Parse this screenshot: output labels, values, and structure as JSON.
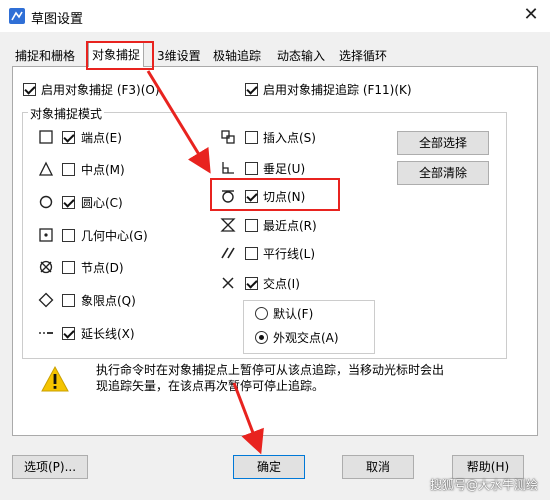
{
  "window": {
    "title": "草图设置",
    "close_glyph": "✕"
  },
  "tabs": [
    {
      "label": "捕捉和栅格",
      "active": false
    },
    {
      "label": "对象捕捉",
      "active": true
    },
    {
      "label": "3维设置",
      "active": false
    },
    {
      "label": "极轴追踪",
      "active": false
    },
    {
      "label": "动态输入",
      "active": false
    },
    {
      "label": "选择循环",
      "active": false
    }
  ],
  "snap_options": {
    "enable_osnap": {
      "label": "启用对象捕捉 (F3)(O)",
      "checked": true
    },
    "enable_tracking": {
      "label": "启用对象捕捉追踪 (F11)(K)",
      "checked": true
    }
  },
  "modes_group_title": "对象捕捉模式",
  "modes_left": [
    {
      "label": "端点(E)",
      "checked": true,
      "icon": "endpoint-square-icon"
    },
    {
      "label": "中点(M)",
      "checked": false,
      "icon": "midpoint-triangle-icon"
    },
    {
      "label": "圆心(C)",
      "checked": true,
      "icon": "center-circle-icon"
    },
    {
      "label": "几何中心(G)",
      "checked": false,
      "icon": "geometric-center-icon"
    },
    {
      "label": "节点(D)",
      "checked": false,
      "icon": "node-icon"
    },
    {
      "label": "象限点(Q)",
      "checked": false,
      "icon": "quadrant-diamond-icon"
    },
    {
      "label": "延长线(X)",
      "checked": true,
      "icon": "extension-icon"
    }
  ],
  "modes_right": [
    {
      "label": "插入点(S)",
      "checked": false,
      "icon": "insertion-icon"
    },
    {
      "label": "垂足(U)",
      "checked": false,
      "icon": "perpendicular-icon"
    },
    {
      "label": "切点(N)",
      "checked": true,
      "icon": "tangent-icon"
    },
    {
      "label": "最近点(R)",
      "checked": false,
      "icon": "nearest-icon"
    },
    {
      "label": "平行线(L)",
      "checked": false,
      "icon": "parallel-icon"
    },
    {
      "label": "交点(I)",
      "checked": true,
      "icon": "intersection-icon"
    }
  ],
  "radios": [
    {
      "label": "默认(F)",
      "selected": false
    },
    {
      "label": "外观交点(A)",
      "selected": true
    }
  ],
  "buttons": {
    "select_all": "全部选择",
    "clear_all": "全部清除",
    "options": "选项(P)...",
    "ok": "确定",
    "cancel": "取消",
    "help": "帮助(H)"
  },
  "hint": {
    "line1": "执行命令时在对象捕捉点上暂停可从该点追踪，当移动光标时会出",
    "line2": "现追踪矢量，在该点再次暂停可停止追踪。"
  },
  "watermark": "搜狐号@大水牛测绘",
  "colors": {
    "highlight": "#e8231f",
    "accent": "#0078d7",
    "warning": "#f5c400"
  }
}
